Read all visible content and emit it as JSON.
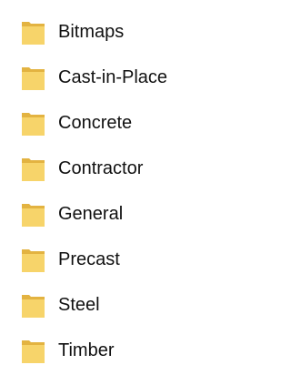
{
  "folders": [
    {
      "label": "Bitmaps",
      "icon": "folder-icon"
    },
    {
      "label": "Cast-in-Place",
      "icon": "folder-icon"
    },
    {
      "label": "Concrete",
      "icon": "folder-icon"
    },
    {
      "label": "Contractor",
      "icon": "folder-icon"
    },
    {
      "label": "General",
      "icon": "folder-icon"
    },
    {
      "label": "Precast",
      "icon": "folder-icon"
    },
    {
      "label": "Steel",
      "icon": "folder-icon"
    },
    {
      "label": "Timber",
      "icon": "folder-icon"
    }
  ],
  "colors": {
    "folder_front": "#F7D46A",
    "folder_back": "#E3B341",
    "text": "#111111"
  }
}
